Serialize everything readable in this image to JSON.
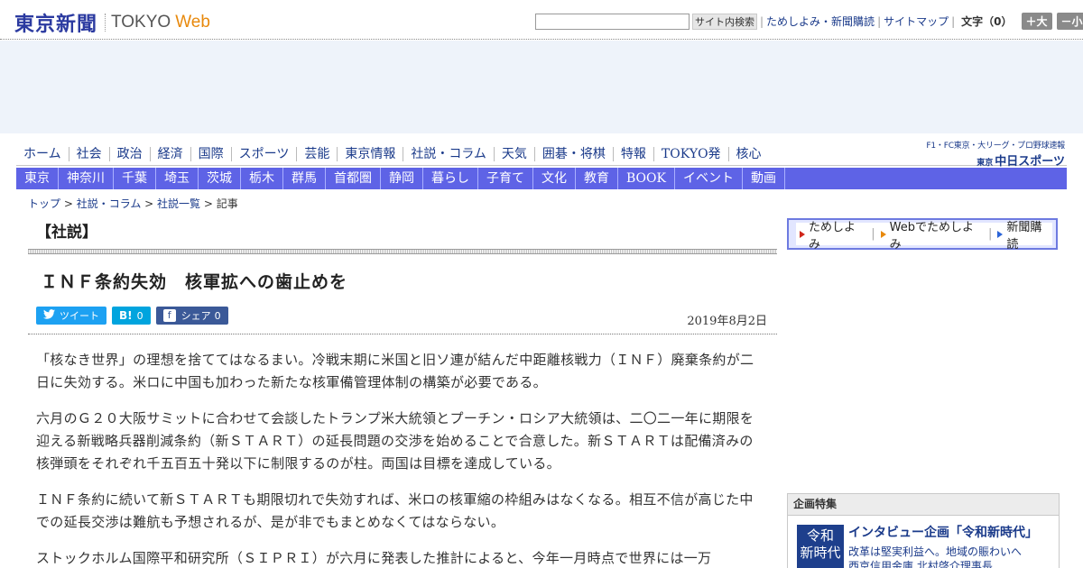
{
  "header": {
    "logo_jp": "東京新聞",
    "logo_tokyo": "TOKYO",
    "logo_web": "Web",
    "search": {
      "value": "",
      "button": "サイト内検索"
    },
    "links": [
      "ためしよみ・新聞購読",
      "サイトマップ"
    ],
    "font_size_label": "文字（0）",
    "font_bigger": "＋大",
    "font_smaller": "－小"
  },
  "nav_primary": [
    "ホーム",
    "社会",
    "政治",
    "経済",
    "国際",
    "スポーツ",
    "芸能",
    "東京情報",
    "社説・コラム",
    "天気",
    "囲碁・将棋",
    "特報",
    "TOKYO発",
    "核心"
  ],
  "chunichi": {
    "top": "F1・FC東京・大リーグ・プロ野球速報",
    "prefix": "東京",
    "name": "中日スポーツ"
  },
  "nav_secondary": [
    "東京",
    "神奈川",
    "千葉",
    "埼玉",
    "茨城",
    "栃木",
    "群馬",
    "首都圏",
    "静岡",
    "暮らし",
    "子育て",
    "文化",
    "教育",
    "BOOK",
    "イベント",
    "動画"
  ],
  "breadcrumb": {
    "items": [
      "トップ",
      "社説・コラム",
      "社説一覧"
    ],
    "current": "記事",
    "sep": " > "
  },
  "article": {
    "label": "【社説】",
    "title": "ＩＮＦ条約失効　核軍拡への歯止めを",
    "date": "2019年8月2日",
    "social": {
      "tweet": "ツイート",
      "hatena_icon": "B!",
      "hatena_count": "0",
      "fb_label": "シェア",
      "fb_count": "0"
    },
    "paragraphs": [
      "「核なき世界」の理想を捨ててはなるまい。冷戦末期に米国と旧ソ連が結んだ中距離核戦力（ＩＮＦ）廃棄条約が二日に失効する。米ロに中国も加わった新たな核軍備管理体制の構築が必要である。",
      "六月のＧ２０大阪サミットに合わせて会談したトランプ米大統領とプーチン・ロシア大統領は、二〇二一年に期限を迎える新戦略兵器削減条約（新ＳＴＡＲＴ）の延長問題の交渉を始めることで合意した。新ＳＴＡＲＴは配備済みの核弾頭をそれぞれ千五百五十発以下に制限するのが柱。両国は目標を達成している。",
      "ＩＮＦ条約に続いて新ＳＴＡＲＴも期限切れで失効すれば、米ロの核軍縮の枠組みはなくなる。相互不信が高じた中での延長交渉は難航も予想されるが、是が非でもまとめなくてはならない。",
      "ストックホルム国際平和研究所（ＳＩＰＲＩ）が六月に発表した推計によると、今年一月時点で世界には一万"
    ]
  },
  "sidebar": {
    "subscribe": [
      "ためしよみ",
      "Webでためしよみ",
      "新聞購読"
    ],
    "feature": {
      "header": "企画特集",
      "thumb": [
        "令和",
        "新時代"
      ],
      "title": "インタビュー企画「令和新時代」",
      "desc": [
        "改革は堅実利益へ。地域の賑わいへ",
        "西京信用金庫 北村啓介理事長"
      ]
    }
  }
}
